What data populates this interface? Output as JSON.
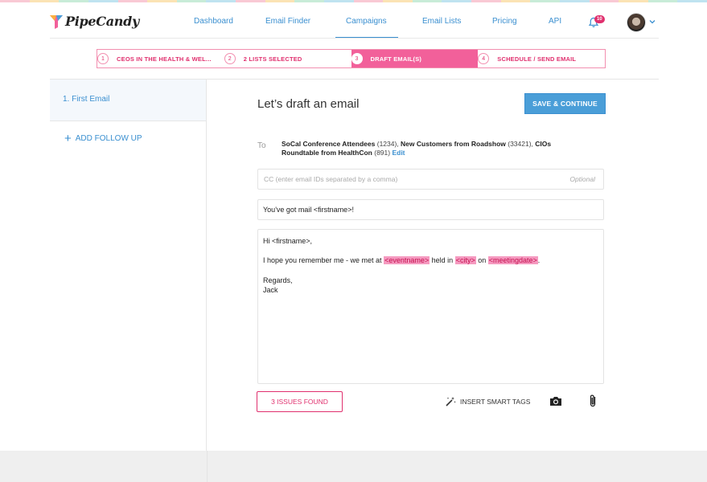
{
  "brand": {
    "name": "PipeCandy"
  },
  "colors": {
    "accent": "#3a8fd0",
    "pink": "#e0306e",
    "step_active": "#f2609a"
  },
  "nav": {
    "items": [
      {
        "label": "Dashboard"
      },
      {
        "label": "Email Finder"
      },
      {
        "label": "Campaigns",
        "active": true
      },
      {
        "label": "Email Lists"
      },
      {
        "label": "Pricing"
      },
      {
        "label": "API"
      }
    ],
    "notifications_count": "10"
  },
  "steps": [
    {
      "num": "1",
      "label": "CEOS IN THE HEALTH & WEL..."
    },
    {
      "num": "2",
      "label": "2 LISTS SELECTED"
    },
    {
      "num": "3",
      "label": "DRAFT EMAIL(S)",
      "active": true
    },
    {
      "num": "4",
      "label": "SCHEDULE / SEND EMAIL"
    }
  ],
  "sidebar": {
    "active_item": "1. First Email",
    "add_follow_up": "ADD FOLLOW UP"
  },
  "main": {
    "title": "Let’s draft an email",
    "save_button": "SAVE & CONTINUE",
    "to_label": "To",
    "recipients": [
      {
        "name": "SoCal Conference Attendees",
        "count": "(1234),"
      },
      {
        "name": "New Customers from Roadshow",
        "count": "(33421),"
      },
      {
        "name": "CIOs Roundtable from HealthCon",
        "count": "(891)"
      }
    ],
    "edit_link": "Edit",
    "cc_placeholder": "CC (enter email IDs separated by a comma)",
    "cc_optional": "Optional",
    "subject": "You've got mail <firstname>!",
    "body": {
      "greeting": "Hi <firstname>,",
      "line1_a": "I hope you remember me - we met at",
      "tag_event": "<eventname>",
      "line1_b": "held in",
      "tag_city": "<city>",
      "line1_c": "on",
      "tag_date": "<meetingdate>",
      "line1_d": ".",
      "regards": "Regards,",
      "signature": "Jack"
    },
    "issues_button": "3 ISSUES FOUND",
    "smart_tags_button": "INSERT SMART TAGS"
  }
}
